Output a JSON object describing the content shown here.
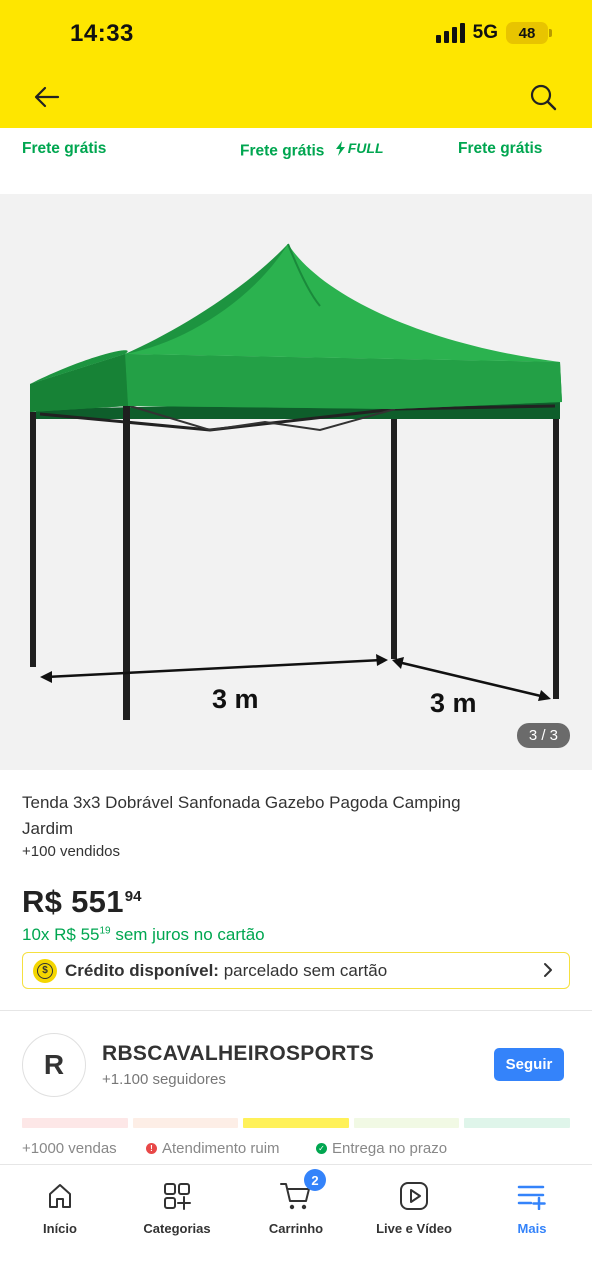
{
  "status_bar": {
    "time": "14:33",
    "network": "5G",
    "battery": "48"
  },
  "frete": {
    "items": [
      {
        "label": "Frete grátis"
      },
      {
        "label": "Frete grátis",
        "full_label": "FULL"
      },
      {
        "label": "Frete grátis"
      }
    ]
  },
  "gallery": {
    "counter": "3 / 3",
    "dimension_left": "3 m",
    "dimension_right": "3 m"
  },
  "product": {
    "title": "Tenda 3x3 Dobrável Sanfonada Gazebo Pagoda Camping Jardim",
    "sold": "+100 vendidos",
    "price_main": "R$ 551",
    "price_cents": "94",
    "installment_prefix": "10x R$ 55",
    "installment_cents": "19",
    "installment_suffix": " sem juros no cartão",
    "credit_bold": "Crédito disponível:",
    "credit_rest": " parcelado sem cartão"
  },
  "seller": {
    "initial": "R",
    "name": "RBSCAVALHEIROSPORTS",
    "followers": "+1.100 seguidores",
    "follow_label": "Seguir",
    "sales": "+1000 vendas",
    "service": "Atendimento ruim",
    "delivery": "Entrega no prazo"
  },
  "colors": {
    "header": "#fee600",
    "green": "#00a650",
    "blue": "#3483fa",
    "thermometer": [
      "#fde7e7",
      "#fdeee6",
      "#fff159",
      "#f1f9e4",
      "#dff5ea"
    ]
  },
  "nav": {
    "items": [
      {
        "label": "Início",
        "icon": "home-icon"
      },
      {
        "label": "Categorias",
        "icon": "categories-icon"
      },
      {
        "label": "Carrinho",
        "icon": "cart-icon",
        "badge": "2"
      },
      {
        "label": "Live e Vídeo",
        "icon": "play-icon"
      },
      {
        "label": "Mais",
        "icon": "menu-plus-icon",
        "active": true
      }
    ]
  }
}
